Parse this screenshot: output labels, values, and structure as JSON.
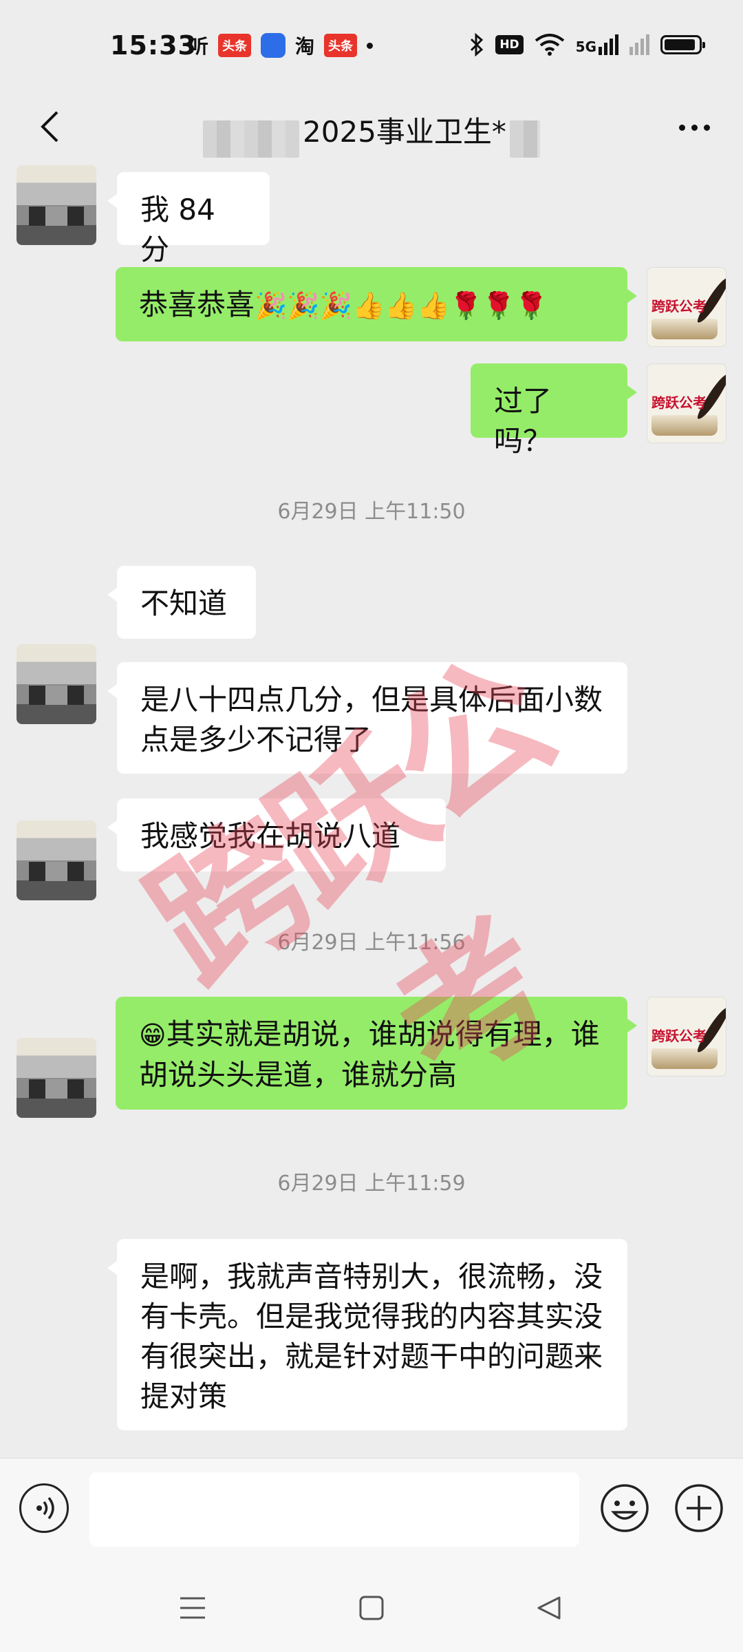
{
  "status_bar": {
    "time": "15:33",
    "left_icons": [
      "listen-icon",
      "toutiao-icon",
      "app-icon",
      "taobao-icon",
      "toutiao-icon",
      "dot-icon"
    ],
    "left_labels": {
      "listen": "听",
      "toutiao": "头条",
      "taobao": "淘"
    },
    "right_icons": [
      "bluetooth-icon",
      "hd-icon",
      "wifi-icon",
      "5g-signal-icon",
      "signal-icon",
      "battery-icon"
    ],
    "hd_label": "HD",
    "network_label": "5G"
  },
  "header": {
    "title": "2025事业卫生*",
    "back_icon": "chevron-left-icon",
    "more_icon": "more-dots-icon"
  },
  "messages": [
    {
      "side": "in",
      "text": "我 84 分"
    },
    {
      "side": "out",
      "text": "恭喜恭喜",
      "emoji": "🎉🎉🎉👍👍👍🌹🌹🌹"
    },
    {
      "side": "out",
      "text": "过了吗？"
    },
    {
      "type": "time",
      "text": "6月29日 上午11:50"
    },
    {
      "side": "in",
      "text": "不知道"
    },
    {
      "side": "in",
      "text": "是八十四点几分，但是具体后面小数点是多少不记得了"
    },
    {
      "side": "in",
      "text": "我感觉我在胡说八道"
    },
    {
      "type": "time",
      "text": "6月29日 上午11:56"
    },
    {
      "side": "out",
      "emoji": "😁",
      "text": "其实就是胡说，谁胡说得有理，谁胡说头头是道，谁就分高"
    },
    {
      "type": "time",
      "text": "6月29日 上午11:59"
    },
    {
      "side": "in",
      "text": "是啊，我就声音特别大，很流畅，没有卡壳。但是我觉得我的内容其实没有很突出，就是针对题干中的问题来提对策"
    }
  ],
  "my_avatar_text": "跨跃公考",
  "watermark": "跨跃公考",
  "input_bar": {
    "value": "",
    "voice_icon": "voice-icon",
    "emoji_icon": "smiley-icon",
    "plus_icon": "plus-circle-icon"
  },
  "nav_bar": [
    "menu-icon",
    "home-square-icon",
    "back-triangle-icon"
  ],
  "colors": {
    "background": "#ededed",
    "bubble_out": "#95ec69",
    "bubble_in": "#ffffff",
    "watermark": "#e8465a"
  }
}
